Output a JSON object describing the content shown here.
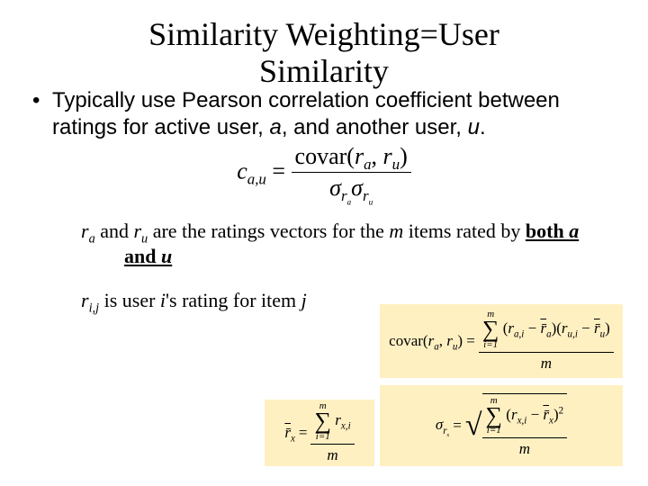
{
  "title_line1": "Similarity Weighting=User",
  "title_line2": "Similarity",
  "bullet_text_pre": "Typically use Pearson correlation coefficient between ratings for active user, ",
  "bullet_a": "a",
  "bullet_mid": ", and another user, ",
  "bullet_u": "u",
  "bullet_end": ".",
  "eq1": {
    "lhs_c": "c",
    "lhs_sub": "a,u",
    "eq": " = ",
    "num_func": "covar(",
    "num_ra": "r",
    "num_ra_sub": "a",
    "num_sep": ", ",
    "num_ru": "r",
    "num_ru_sub": "u",
    "num_close": ")",
    "den_s1": "σ",
    "den_s1_sub": "r",
    "den_s1_ssub": "a",
    "den_s2": "σ",
    "den_s2_sub": "r",
    "den_s2_ssub": "u"
  },
  "note1": {
    "ra": "r",
    "ra_sub": "a",
    "and": " and ",
    "ru": "r",
    "ru_sub": "u",
    "rest1": " are the ratings vectors for the ",
    "m": "m",
    "rest2": " items rated by ",
    "both": "both ",
    "a": "a",
    "and2": " and ",
    "u": "u"
  },
  "note2": {
    "r": "r",
    "r_sub": "i,j",
    "rest1": " is user ",
    "i": "i",
    "rest2": "'s rating for item ",
    "j": "j"
  },
  "rbar": {
    "lhs": "r̄",
    "lhs_sub": "x",
    "eq": " = ",
    "sum_top": "m",
    "sum_bot": "i=1",
    "term": "r",
    "term_sub": "x,i",
    "den": "m"
  },
  "covar": {
    "lhs": "covar(",
    "ra": "r",
    "ra_sub": "a",
    "sep": ", ",
    "ru": "r",
    "ru_sub": "u",
    "close": ") = ",
    "sum_top": "m",
    "sum_bot": "i=1",
    "open": "(",
    "t1": "r",
    "t1_sub": "a,i",
    "minus": " − ",
    "t1b": "r̄",
    "t1b_sub": "a",
    "mid": ")(",
    "t2": "r",
    "t2_sub": "u,i",
    "t2b": "r̄",
    "t2b_sub": "u",
    "end": ")",
    "den": "m"
  },
  "sigma": {
    "lhs": "σ",
    "lhs_sub": "r",
    "lhs_ssub": "x",
    "eq": " = ",
    "sum_top": "m",
    "sum_bot": "i=1",
    "open": "(",
    "t1": "r",
    "t1_sub": "x,i",
    "minus": " − ",
    "t1b": "r̄",
    "t1b_sub": "x",
    "close": ")",
    "pow": "2",
    "den": "m"
  }
}
